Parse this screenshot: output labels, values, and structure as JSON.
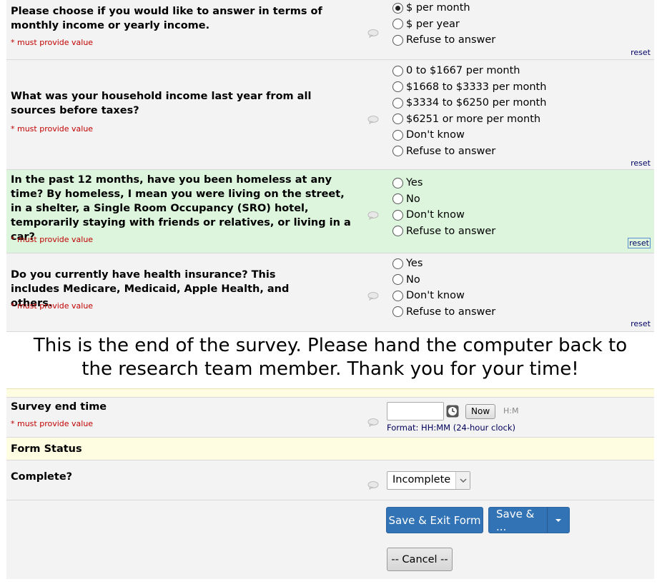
{
  "questions": [
    {
      "text": "Please choose if you would like to answer in terms of monthly income or yearly income.",
      "required": "* must provide value",
      "options": [
        "$ per month",
        "$ per year",
        "Refuse to answer"
      ],
      "selected": 0,
      "reset": "reset"
    },
    {
      "text": "What was your household income last year from all sources before taxes?",
      "required": "* must provide value",
      "options": [
        "0 to $1667 per month",
        "$1668 to $3333 per month",
        "$3334 to $6250 per month",
        "$6251 or more per month",
        "Don't know",
        "Refuse to answer"
      ],
      "selected": -1,
      "reset": "reset"
    },
    {
      "text": "In the past 12 months, have you been homeless at any time? By homeless, I mean you were living on the street, in a shelter, a Single Room Occupancy (SRO) hotel, temporarily staying with friends or relatives, or living in a car?",
      "required": "* must provide value",
      "options": [
        "Yes",
        "No",
        "Don't know",
        "Refuse to answer"
      ],
      "selected": -1,
      "reset": "reset"
    },
    {
      "text": "Do you currently have health insurance? This includes Medicare, Medicaid, Apple Health, and others.",
      "required": "* must provide value",
      "options": [
        "Yes",
        "No",
        "Don't know",
        "Refuse to answer"
      ],
      "selected": -1,
      "reset": "reset"
    }
  ],
  "end_message": "This is the end of the survey. Please hand the computer back to the research team member. Thank you for your time!",
  "end_time": {
    "label": "Survey end time",
    "required": "* must provide value",
    "value": "",
    "now_label": "Now",
    "hm_label": "H:M",
    "format_hint": "Format: HH:MM (24-hour clock)"
  },
  "form_status": {
    "header": "Form Status",
    "complete_label": "Complete?",
    "selected": "Incomplete"
  },
  "buttons": {
    "save_exit": "Save & Exit Form",
    "save_more": "Save & ...",
    "cancel": "-- Cancel --"
  },
  "colors": {
    "highlight_row": "#dcf5dc",
    "required_text": "#c00000",
    "primary_button": "#3273b5"
  }
}
